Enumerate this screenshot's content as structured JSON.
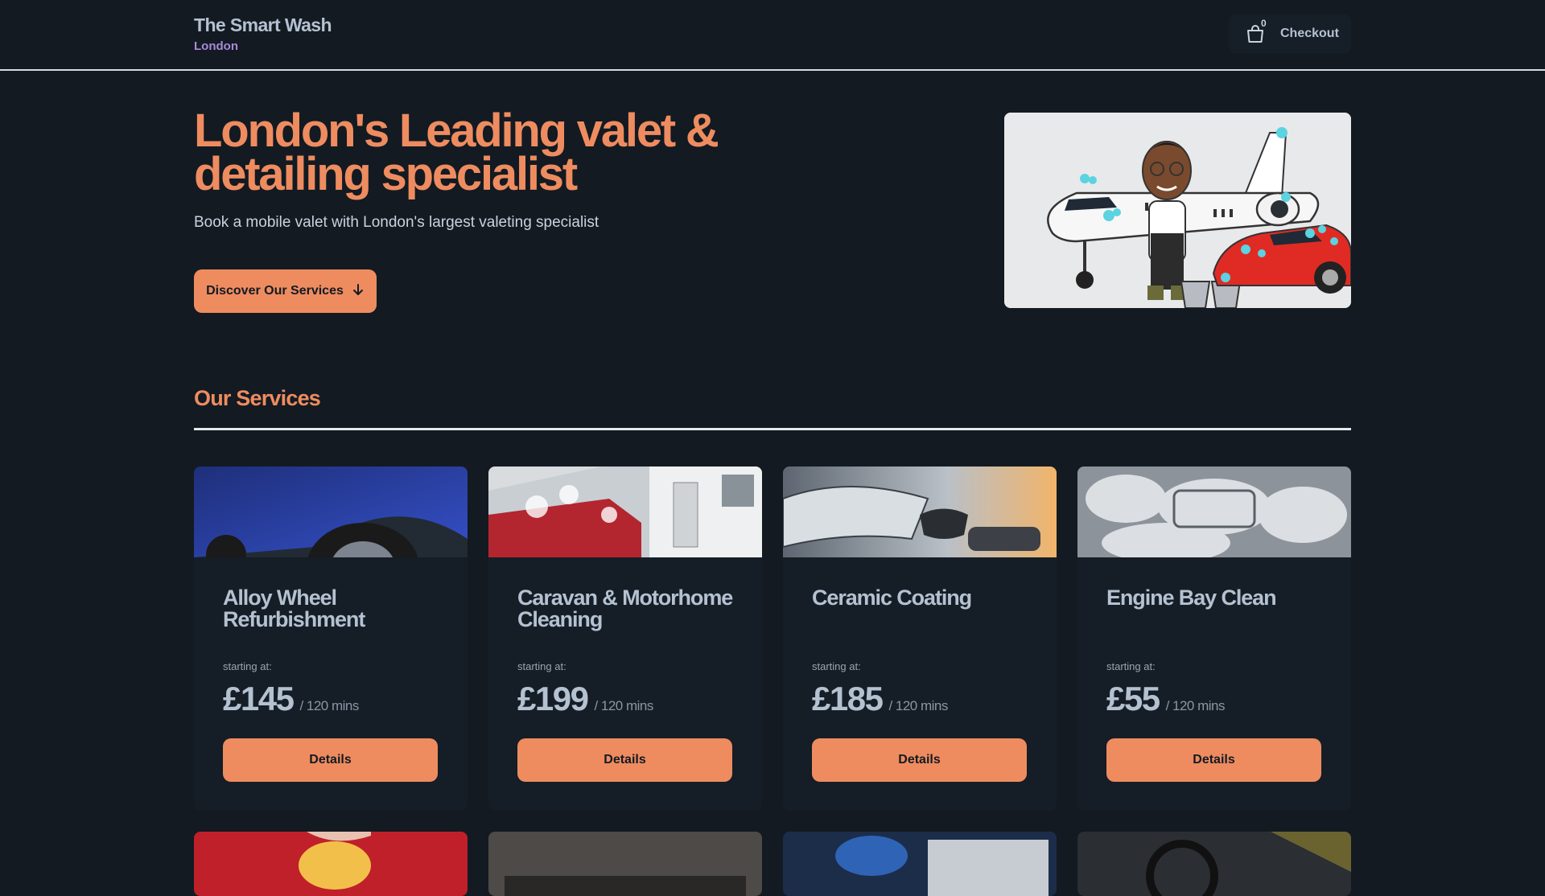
{
  "header": {
    "brand_name": "The Smart Wash",
    "brand_city": "London",
    "cart_count": "0",
    "checkout_label": "Checkout"
  },
  "hero": {
    "title": "London's Leading valet & detailing specialist",
    "subtitle": "Book a mobile valet with London's largest valeting specialist",
    "cta_label": "Discover Our Services",
    "image_alt": "Cartoon valeter washing a private jet and red sports car"
  },
  "services": {
    "title": "Our Services",
    "starting_label": "starting at:",
    "details_label": "Details",
    "items": [
      {
        "title": "Alloy Wheel Refurbishment",
        "price": "£145",
        "duration": "/ 120 mins"
      },
      {
        "title": "Caravan & Motorhome Cleaning",
        "price": "£199",
        "duration": "/ 120 mins"
      },
      {
        "title": "Ceramic Coating",
        "price": "£185",
        "duration": "/ 120 mins"
      },
      {
        "title": "Engine Bay Clean",
        "price": "£55",
        "duration": "/ 120 mins"
      }
    ]
  },
  "colors": {
    "background": "#131a22",
    "accent": "#ee8c60",
    "city": "#a98ad9",
    "card": "#151d26"
  },
  "icons": [
    "shopping-bag-icon",
    "arrow-down-icon"
  ]
}
